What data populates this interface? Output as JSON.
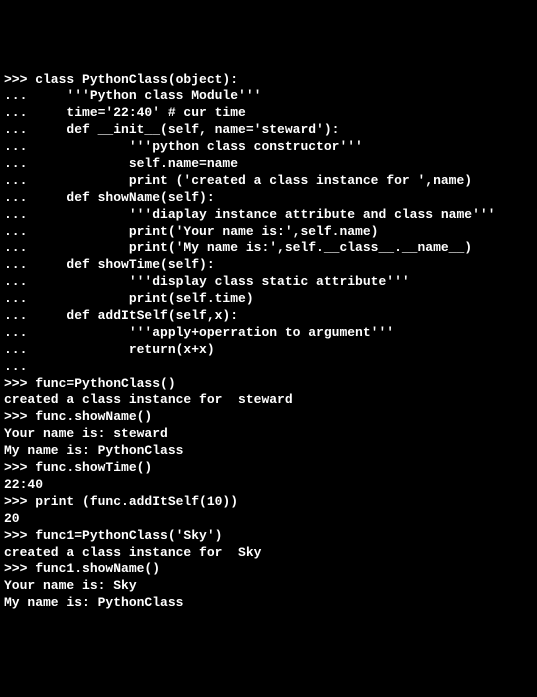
{
  "lines": [
    ">>> class PythonClass(object):",
    "...     '''Python class Module'''",
    "...     time='22:40' # cur time",
    "...     def __init__(self, name='steward'):",
    "...             '''python class constructor'''",
    "...             self.name=name",
    "...             print ('created a class instance for ',name)",
    "...     def showName(self):",
    "...             '''diaplay instance attribute and class name'''",
    "...             print('Your name is:',self.name)",
    "...             print('My name is:',self.__class__.__name__)",
    "...     def showTime(self):",
    "...             '''display class static attribute'''",
    "...             print(self.time)",
    "...     def addItSelf(self,x):",
    "...             '''apply+operration to argument'''",
    "...             return(x+x)",
    "...",
    ">>> func=PythonClass()",
    "created a class instance for  steward",
    ">>> func.showName()",
    "Your name is: steward",
    "My name is: PythonClass",
    ">>> func.showTime()",
    "22:40",
    ">>> print (func.addItSelf(10))",
    "20",
    ">>> func1=PythonClass('Sky')",
    "created a class instance for  Sky",
    ">>> func1.showName()",
    "Your name is: Sky",
    "My name is: PythonClass"
  ]
}
